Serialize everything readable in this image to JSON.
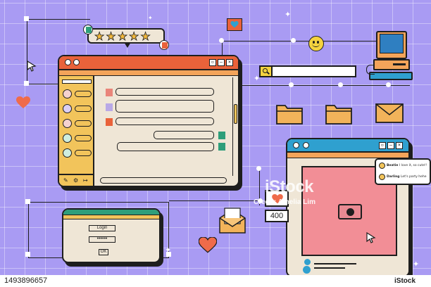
{
  "rating": {
    "stars": 5,
    "max": 5
  },
  "search": {
    "value": ""
  },
  "login_window": {
    "username_label": "Login",
    "password_mask": "••••••",
    "ok_label": "OK"
  },
  "notification": {
    "count": "400"
  },
  "comments": [
    {
      "name": "Beatie",
      "text": "I love it, so cute!!"
    },
    {
      "name": "Darling",
      "text": "Let's party hehe"
    }
  ],
  "watermark": {
    "brand": "iStock",
    "credit": "Credit: Amelia  Lim"
  },
  "stock_id": "1493896657",
  "colors": {
    "background": "#a99bf3",
    "titlebar_orange": "#e9623a",
    "titlebar_blue": "#2fa0cf",
    "titlebar_green": "#2e9e7a",
    "sidebar_yellow": "#f2c45b",
    "window_cream": "#efe6d6",
    "photo_pink": "#f28e96",
    "heart_red": "#ef6b4a"
  },
  "icons": [
    "star-icon",
    "user-icon",
    "cursor-icon",
    "heart-icon",
    "smiley-icon",
    "retro-computer-icon",
    "search-icon",
    "folder-icon",
    "envelope-icon",
    "camera-icon",
    "like-heart-icon",
    "sparkle-icon",
    "minimize-icon",
    "maximize-icon",
    "close-icon"
  ]
}
